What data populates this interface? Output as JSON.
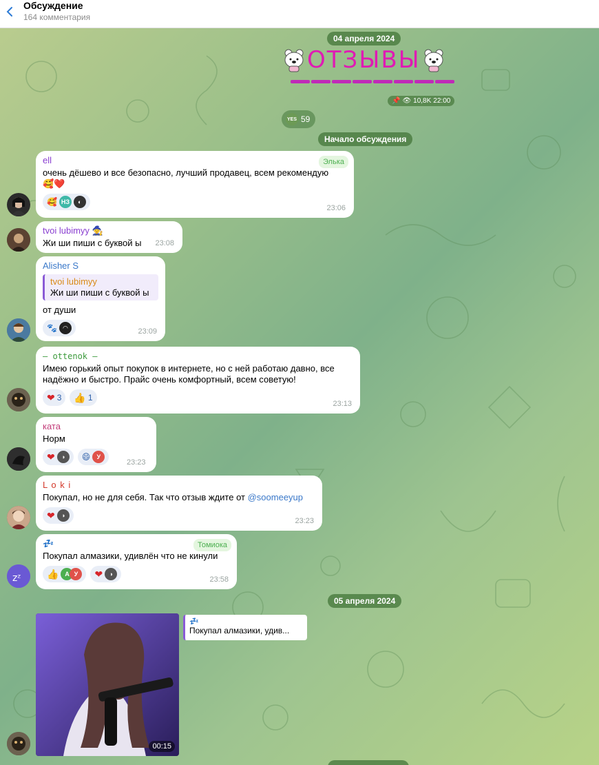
{
  "header": {
    "title": "Обсуждение",
    "subtitle": "164 комментария"
  },
  "post": {
    "date": "04 апреля 2024",
    "title": "ОТЗЫВЫ",
    "views": "10,8K",
    "time": "22:00",
    "reaction_count": "59",
    "reaction_label": "YES"
  },
  "discussion_start": "Начало обсуждения",
  "messages": [
    {
      "author": "ell",
      "author_color": "#8a3fd1",
      "badge": "Элька",
      "text": "очень дёшево и все безопасно, лучший продавец, всем рекомендую",
      "emoji_line": "🥰❤️",
      "time": "23:06",
      "reaction_initials": "НЗ"
    },
    {
      "author": "tvoi lubimyy",
      "author_color": "#8a3fd1",
      "text": "Жи ши пиши с буквой ы",
      "time": "23:08"
    },
    {
      "author": "Alisher S",
      "author_color": "#3a78c9",
      "reply_author": "tvoi lubimyy",
      "reply_text": "Жи ши пиши с буквой ы",
      "text": "от души",
      "time": "23:09"
    },
    {
      "author": "— ottenok —",
      "author_color": "#3c9a3c",
      "text": "Имею горький опыт покупок в интернете, но с ней работаю давно, все надёжно и быстро. Прайс очень комфортный, всем советую!",
      "time": "23:13",
      "heart_count": "3",
      "thumb_count": "1"
    },
    {
      "author": "ката",
      "author_color": "#c23b78",
      "text": "Норм",
      "time": "23:23",
      "reaction_initial": "У"
    },
    {
      "author": "L o k i",
      "author_color": "#d33a2c",
      "text": "Покупал, но не для себя. Так что отзыв ждите от",
      "mention": "@soomeeyup",
      "time": "23:23"
    },
    {
      "author": "💤",
      "author_color": "#8a3fd1",
      "badge": "Томиока",
      "text": "Покупал алмазики, удивлён что не кинули",
      "time": "23:58",
      "reaction_initial_a": "А",
      "reaction_initial_u": "У"
    }
  ],
  "date_2": "05 апреля 2024",
  "video": {
    "duration": "00:15",
    "reply_author": "💤",
    "reply_text": "Покупал алмазики, удив..."
  },
  "colors": {
    "pill_bg": "#4d7a42",
    "title_pink": "#e01ab4",
    "time_gray": "#9aa3a0"
  }
}
